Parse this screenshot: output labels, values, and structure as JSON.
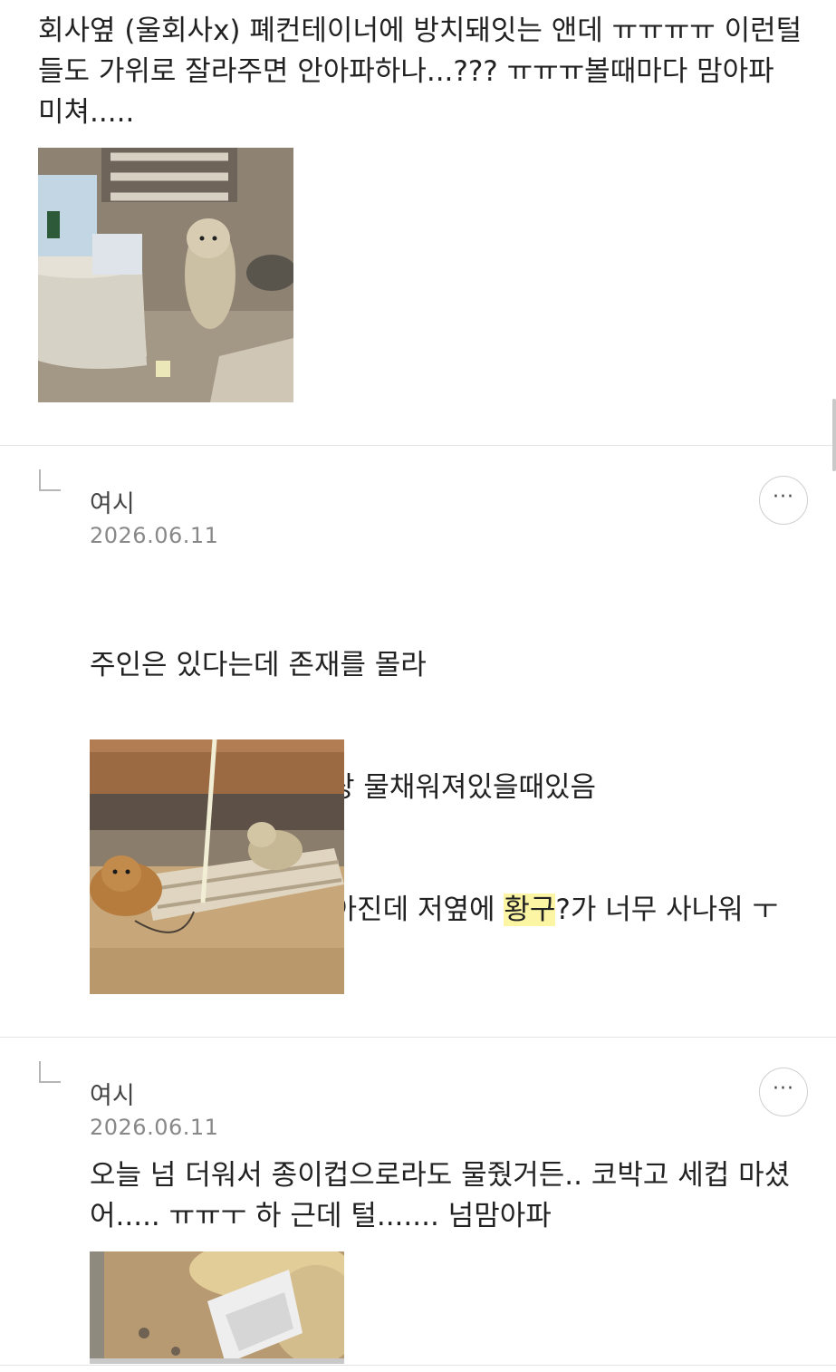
{
  "post": {
    "text": "회사옆 (울회사x) 폐컨테이너에 방치돼잇는 앤데 ㅠㅠㅠㅠ 이런털들도 가위로 잘라주면 안아파하나...??? ㅠㅠㅠ볼때마다 맘아파 미쳐.....",
    "photo_icon": "photo-small-dog-by-shelter"
  },
  "comments": [
    {
      "author": "여시",
      "date": "2026.06.11",
      "lines": [
        {
          "text": "주인은 있다는데 존재를 몰라"
        },
        {
          "text": "어~쩌다한번씩 사료랑 물채워져있을때있음"
        },
        {
          "before": "소형견은 사람좋아강아진데 저옆에 ",
          "highlight": "황구",
          "after": "?가 너무 사나워 ㅜㅜ"
        }
      ],
      "highlight_color": "#fbf5a4",
      "photo_icon": "photo-two-dogs-on-pallet"
    },
    {
      "author": "여시",
      "date": "2026.06.11",
      "text": "오늘 넘 더워서 종이컵으로라도 물줬거든.. 코박고 세컵 마셨어..... ㅠㅠㅜ 하 근데 털....... 넘맘아파",
      "photo_icon": "photo-dog-drinking-from-cup"
    }
  ],
  "ui": {
    "more_label": "···",
    "reply_icon": "reply-indent-icon",
    "more_icon": "more-options-icon"
  }
}
